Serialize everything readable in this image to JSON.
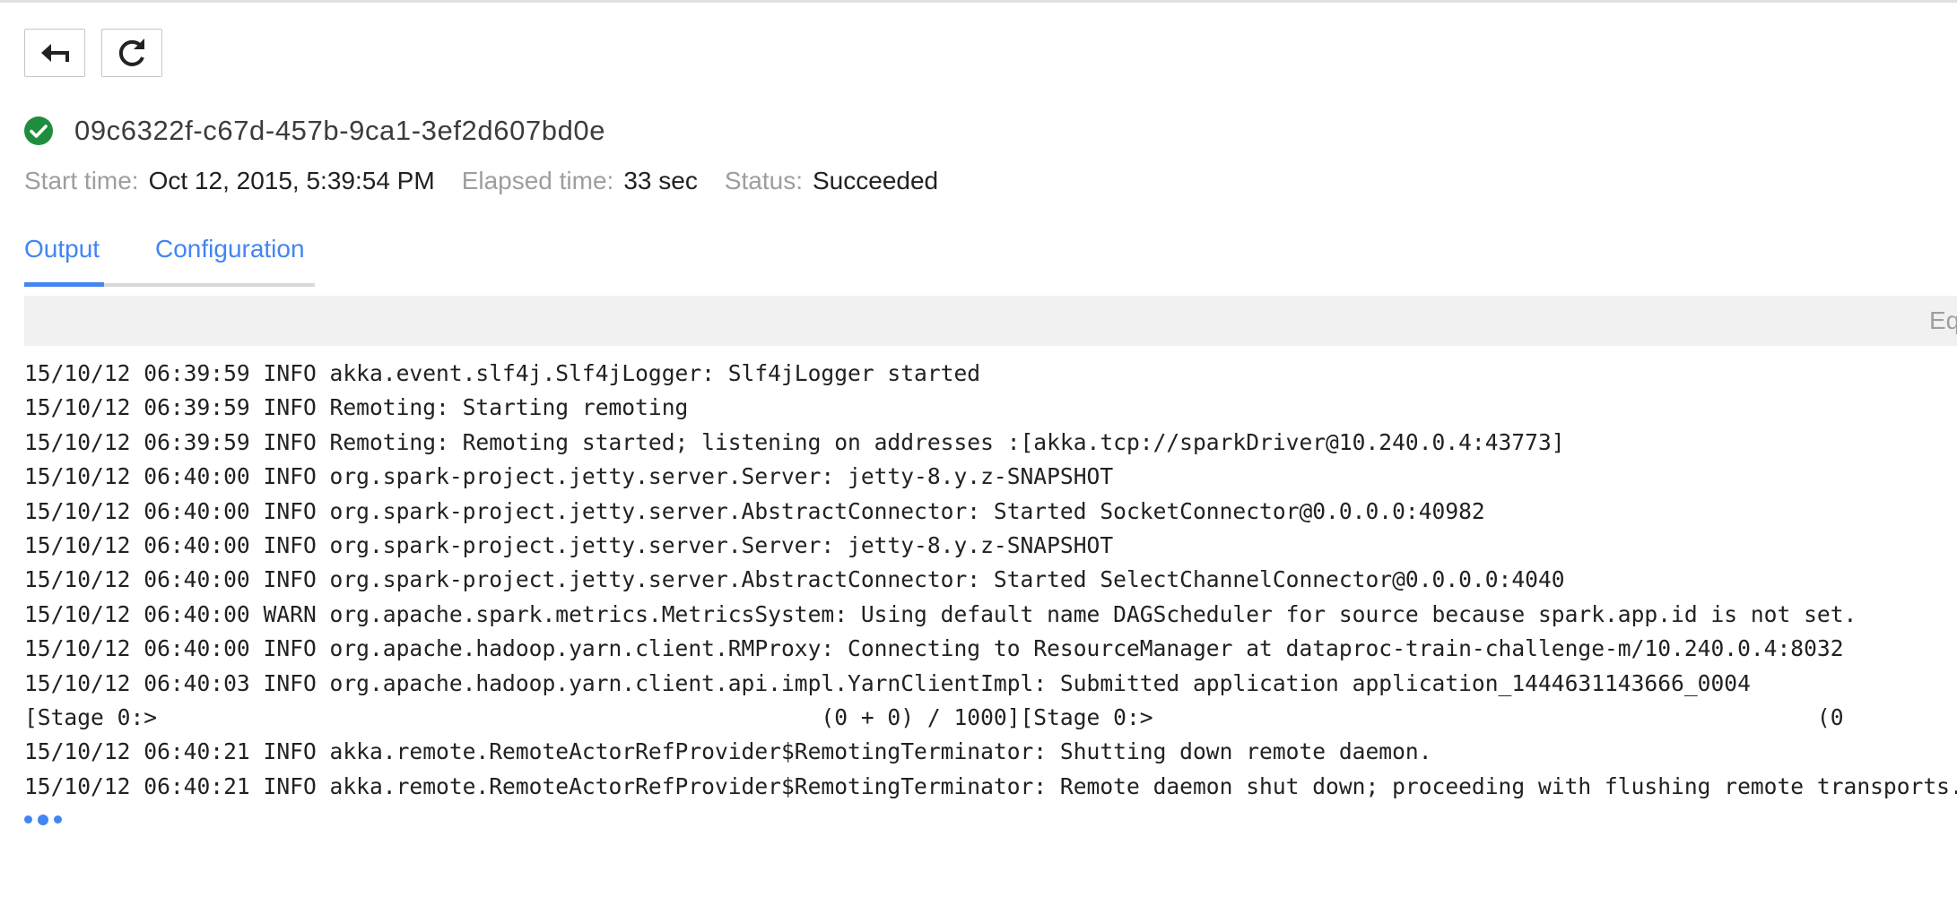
{
  "colors": {
    "accent": "#4285f4",
    "success": "#1e8e3e",
    "label_gray": "#9e9e9e"
  },
  "toolbar": {
    "back_icon": "back-arrow-icon",
    "refresh_icon": "refresh-icon"
  },
  "job": {
    "status_icon": "success-check-icon",
    "id": "09c6322f-c67d-457b-9ca1-3ef2d607bd0e",
    "start_time_label": "Start time:",
    "start_time": "Oct 12, 2015, 5:39:54 PM",
    "elapsed_label": "Elapsed time:",
    "elapsed": "33 sec",
    "status_label": "Status:",
    "status": "Succeeded"
  },
  "tabs": {
    "output": "Output",
    "configuration": "Configuration",
    "active": "output"
  },
  "log_header": {
    "right_text": "Eq"
  },
  "log_lines": [
    "15/10/12 06:39:59 INFO akka.event.slf4j.Slf4jLogger: Slf4jLogger started",
    "15/10/12 06:39:59 INFO Remoting: Starting remoting",
    "15/10/12 06:39:59 INFO Remoting: Remoting started; listening on addresses :[akka.tcp://sparkDriver@10.240.0.4:43773]",
    "15/10/12 06:40:00 INFO org.spark-project.jetty.server.Server: jetty-8.y.z-SNAPSHOT",
    "15/10/12 06:40:00 INFO org.spark-project.jetty.server.AbstractConnector: Started SocketConnector@0.0.0.0:40982",
    "15/10/12 06:40:00 INFO org.spark-project.jetty.server.Server: jetty-8.y.z-SNAPSHOT",
    "15/10/12 06:40:00 INFO org.spark-project.jetty.server.AbstractConnector: Started SelectChannelConnector@0.0.0.0:4040",
    "15/10/12 06:40:00 WARN org.apache.spark.metrics.MetricsSystem: Using default name DAGScheduler for source because spark.app.id is not set.",
    "15/10/12 06:40:00 INFO org.apache.hadoop.yarn.client.RMProxy: Connecting to ResourceManager at dataproc-train-challenge-m/10.240.0.4:8032",
    "15/10/12 06:40:03 INFO org.apache.hadoop.yarn.client.api.impl.YarnClientImpl: Submitted application application_1444631143666_0004",
    "[Stage 0:>                                                  (0 + 0) / 1000][Stage 0:>                                                  (0",
    "15/10/12 06:40:21 INFO akka.remote.RemoteActorRefProvider$RemotingTerminator: Shutting down remote daemon.",
    "15/10/12 06:40:21 INFO akka.remote.RemoteActorRefProvider$RemotingTerminator: Remote daemon shut down; proceeding with flushing remote transports."
  ],
  "loading_icon": "loading-dots-icon"
}
